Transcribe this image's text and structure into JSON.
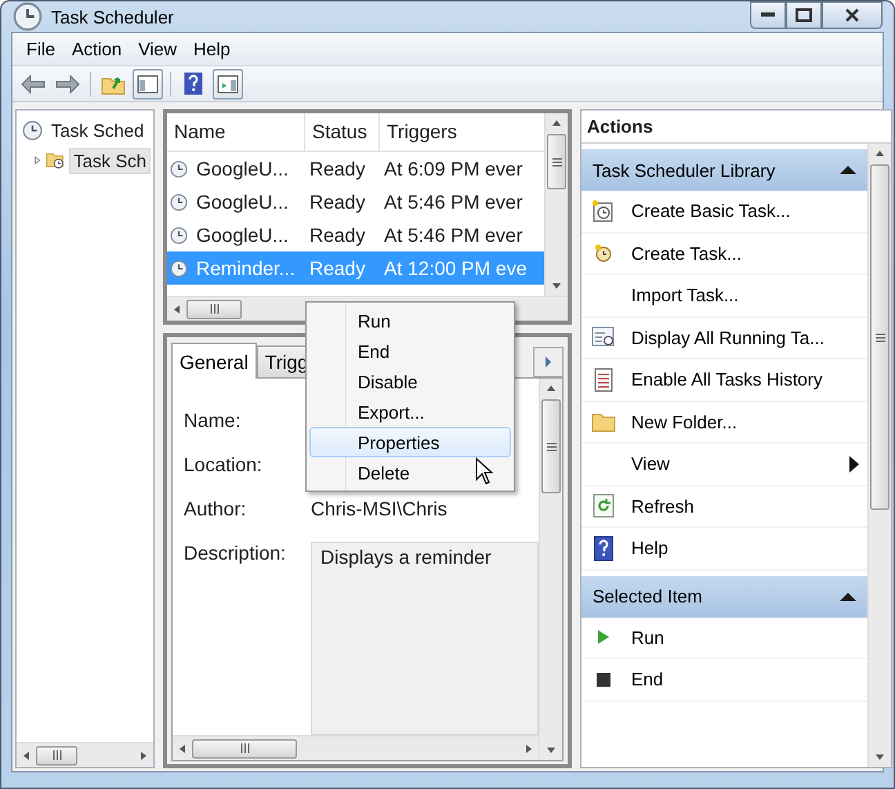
{
  "window": {
    "title": "Task Scheduler"
  },
  "menu": [
    {
      "label": "File"
    },
    {
      "label": "Action"
    },
    {
      "label": "View"
    },
    {
      "label": "Help"
    }
  ],
  "tree": {
    "items": [
      {
        "label": "Task Sched",
        "children": [
          {
            "label": "Task Sch",
            "selected": true,
            "expanded": false
          }
        ]
      }
    ]
  },
  "task_list": {
    "columns": [
      "Name",
      "Status",
      "Triggers"
    ],
    "rows": [
      {
        "cells": [
          "GoogleU...",
          "Ready",
          "At 6:09 PM ever"
        ],
        "selected": false
      },
      {
        "cells": [
          "GoogleU...",
          "Ready",
          "At 5:46 PM ever"
        ],
        "selected": false
      },
      {
        "cells": [
          "GoogleU...",
          "Ready",
          "At 5:46 PM ever"
        ],
        "selected": false
      },
      {
        "cells": [
          "Reminder...",
          "Ready",
          "At 12:00 PM eve"
        ],
        "selected": true
      }
    ]
  },
  "details": {
    "tabs": [
      {
        "label": "General",
        "selected": true
      },
      {
        "label": "Trigg",
        "selected": false
      }
    ],
    "fields": [
      {
        "label": "Name:",
        "kind": "text"
      },
      {
        "label": "Location:",
        "kind": "text"
      },
      {
        "label": "Author:",
        "kind": "text",
        "value": "Chris-MSI\\Chris"
      },
      {
        "label": "Description:",
        "kind": "box",
        "value": "Displays a reminder"
      }
    ]
  },
  "actions": {
    "title": "Actions",
    "sections": [
      {
        "title": "Task Scheduler Library",
        "expanded": true,
        "items": [
          {
            "label": "Create Basic Task...",
            "submenu": false
          },
          {
            "label": "Create Task...",
            "submenu": false
          },
          {
            "label": "Import Task...",
            "submenu": false
          },
          {
            "label": "Display All Running Ta...",
            "submenu": false
          },
          {
            "label": "Enable All Tasks History",
            "submenu": false
          },
          {
            "label": "New Folder...",
            "submenu": false
          },
          {
            "label": "View",
            "submenu": true
          },
          {
            "label": "Refresh",
            "submenu": false
          },
          {
            "label": "Help",
            "submenu": false
          }
        ]
      },
      {
        "title": "Selected Item",
        "expanded": true,
        "items": [
          {
            "label": "Run",
            "submenu": false
          },
          {
            "label": "End",
            "submenu": false
          }
        ]
      }
    ]
  },
  "context_menu": {
    "items": [
      {
        "label": "Run",
        "selected": false
      },
      {
        "label": "End",
        "selected": false
      },
      {
        "label": "Disable",
        "selected": false
      },
      {
        "label": "Export...",
        "selected": false
      },
      {
        "label": "Properties",
        "selected": true
      },
      {
        "label": "Delete",
        "selected": false
      }
    ]
  }
}
